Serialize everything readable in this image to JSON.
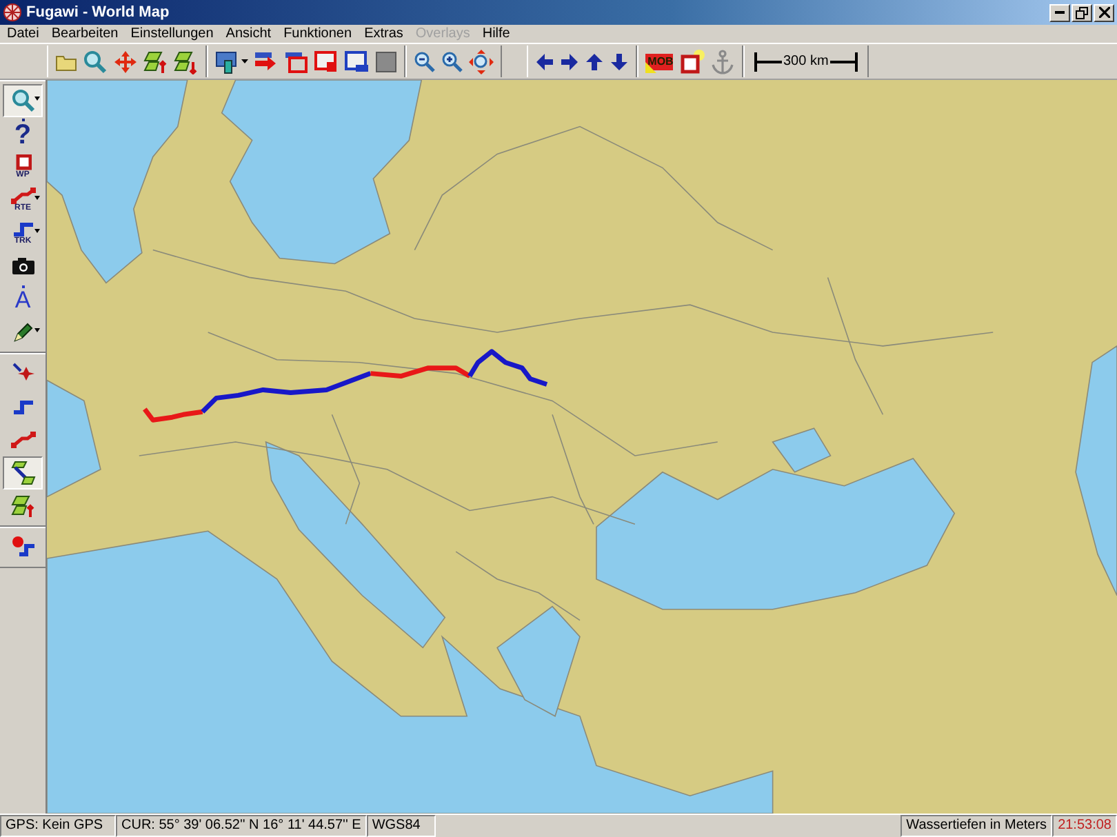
{
  "window": {
    "title": "Fugawi - World Map"
  },
  "menu": [
    {
      "label": "Datei",
      "disabled": false
    },
    {
      "label": "Bearbeiten",
      "disabled": false
    },
    {
      "label": "Einstellungen",
      "disabled": false
    },
    {
      "label": "Ansicht",
      "disabled": false
    },
    {
      "label": "Funktionen",
      "disabled": false
    },
    {
      "label": "Extras",
      "disabled": false
    },
    {
      "label": "Overlays",
      "disabled": true
    },
    {
      "label": "Hilfe",
      "disabled": false
    }
  ],
  "toolbar": [
    [
      {
        "kind": "folder"
      },
      {
        "kind": "magnifier"
      },
      {
        "kind": "move-arrows"
      },
      {
        "kind": "map-up"
      },
      {
        "kind": "map-down"
      }
    ],
    [
      {
        "kind": "monitor",
        "dropdown": true
      },
      {
        "kind": "red-arrow"
      },
      {
        "kind": "window-frame"
      },
      {
        "kind": "window-corner"
      },
      {
        "kind": "window-blue"
      },
      {
        "kind": "gray-square"
      }
    ],
    [
      {
        "kind": "zoom-out"
      },
      {
        "kind": "zoom-in"
      },
      {
        "kind": "zoom-fit"
      }
    ],
    [
      {
        "kind": "arrow-left"
      },
      {
        "kind": "arrow-right"
      },
      {
        "kind": "arrow-up"
      },
      {
        "kind": "arrow-down"
      }
    ],
    [
      {
        "kind": "mob-flag",
        "label": "MOB"
      },
      {
        "kind": "red-square"
      },
      {
        "kind": "anchor"
      }
    ]
  ],
  "scale": {
    "label": "300 km"
  },
  "side_toolbar": [
    [
      {
        "kind": "magnifier",
        "dropdown": true,
        "selected": true
      },
      {
        "kind": "question",
        "label": "?",
        "selected": false
      },
      {
        "kind": "waypoint",
        "label": "WP",
        "selected": false
      },
      {
        "kind": "route",
        "label": "RTE",
        "dropdown": true,
        "selected": false
      },
      {
        "kind": "track",
        "label": "TRK",
        "dropdown": true,
        "selected": false
      },
      {
        "kind": "camera",
        "selected": false
      },
      {
        "kind": "letter",
        "label": "A",
        "selected": false
      },
      {
        "kind": "pen",
        "dropdown": true,
        "selected": false
      }
    ],
    [
      {
        "kind": "goto-point",
        "selected": false
      },
      {
        "kind": "goto-track",
        "selected": false
      },
      {
        "kind": "goto-route",
        "selected": false
      },
      {
        "kind": "map-select",
        "selected": true
      },
      {
        "kind": "map-up",
        "selected": false
      }
    ],
    [
      {
        "kind": "record",
        "selected": false
      }
    ]
  ],
  "status_bar": [
    {
      "text": "GPS: Kein GPS",
      "alert": false
    },
    {
      "text": "CUR: 55° 39' 06.52'' N 16° 11' 44.57'' E",
      "alert": false
    },
    {
      "text": "WGS84",
      "alert": false
    },
    {
      "text": "Wassertiefen in Meters",
      "alert": false
    },
    {
      "text": "21:53:08",
      "alert": true
    }
  ]
}
